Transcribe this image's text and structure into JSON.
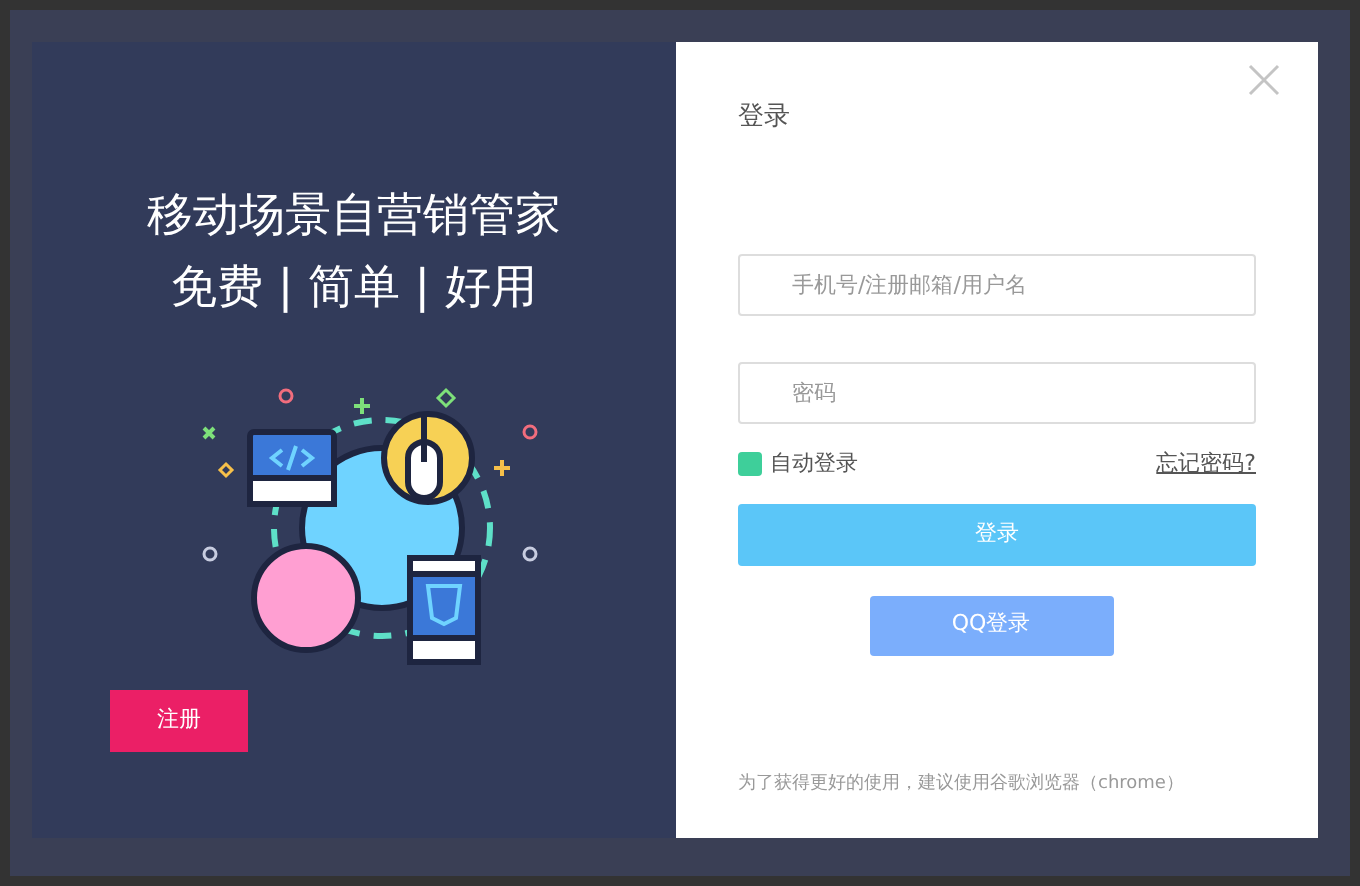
{
  "promo": {
    "headline": "移动场景自营销管家",
    "tagline": "免费 | 简单 | 好用",
    "register_button": "注册"
  },
  "login": {
    "title": "登录",
    "fields": [
      {
        "placeholder": "手机号/注册邮箱/用户名"
      },
      {
        "placeholder": "密码"
      }
    ],
    "remember": {
      "label": "自动登录",
      "checked": true
    },
    "forgot_link": "忘记密码?",
    "submit_button": "登录",
    "qq_button": "QQ登录",
    "footer_note": "为了获得更好的使用，建议使用谷歌浏览器（chrome）"
  }
}
